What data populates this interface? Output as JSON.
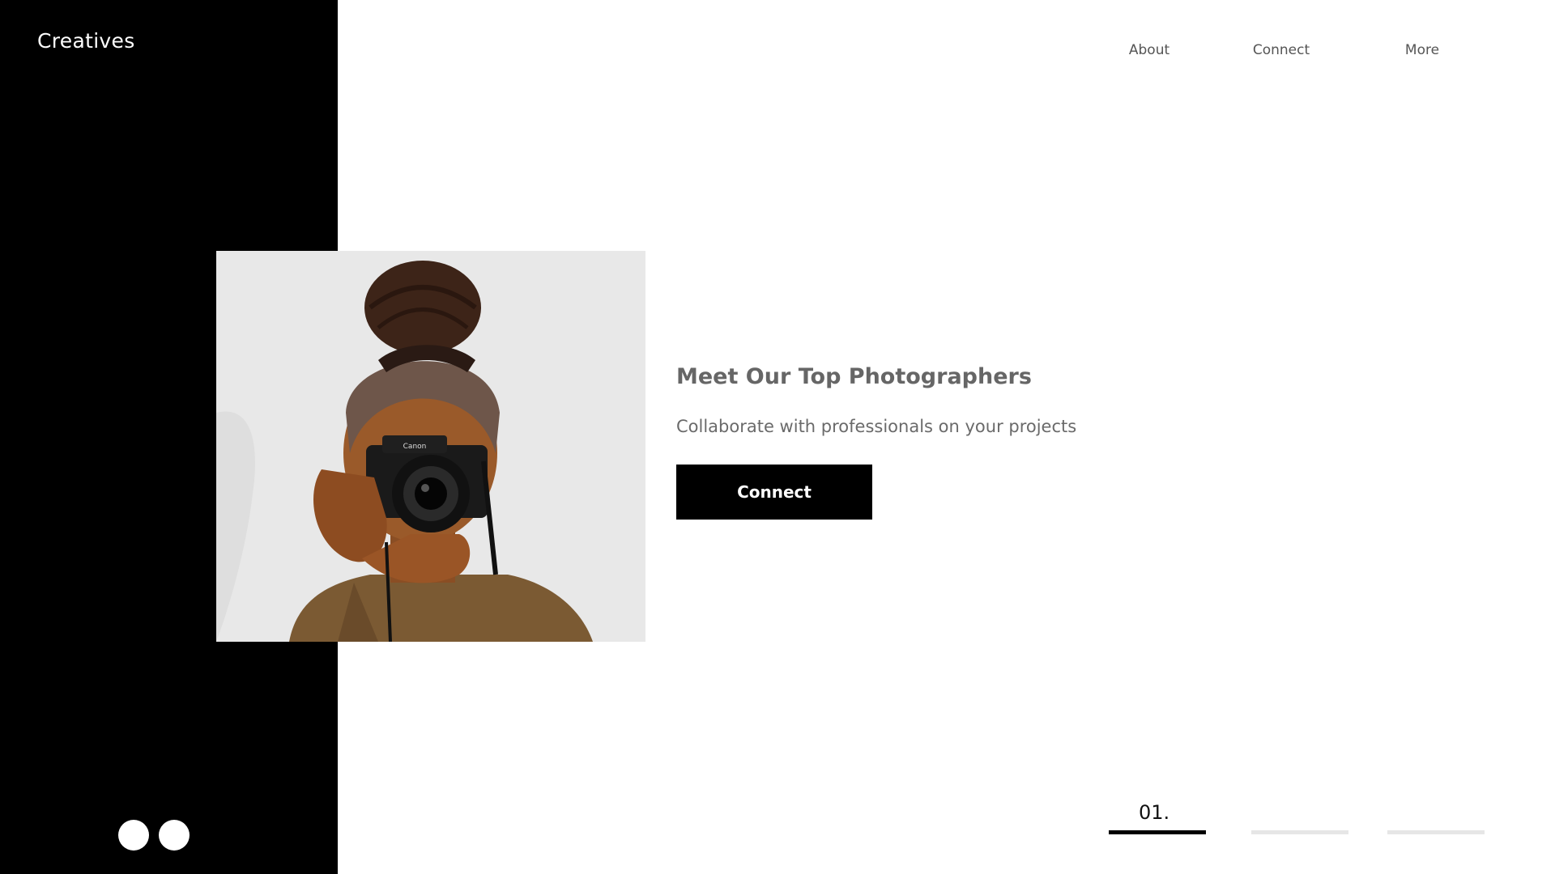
{
  "app": {
    "brand": "Creatives"
  },
  "nav": {
    "items": [
      {
        "label": "About"
      },
      {
        "label": "Connect"
      },
      {
        "label": "More"
      }
    ]
  },
  "hero": {
    "title": "Meet Our Top Photographers",
    "subtitle": "Collaborate with professionals on your projects",
    "cta_label": "Connect",
    "image_icon": "photographer-photo"
  },
  "slider": {
    "current_number": "01.",
    "total_slides": 3,
    "active_index": 0
  },
  "dots": {
    "count": 2
  },
  "colors": {
    "sidebar": "#000000",
    "accent": "#000000",
    "text_muted": "#666666",
    "inactive_bar": "#e6e6e6",
    "active_bar": "#000000",
    "image_bg": "#e8e8e8"
  }
}
